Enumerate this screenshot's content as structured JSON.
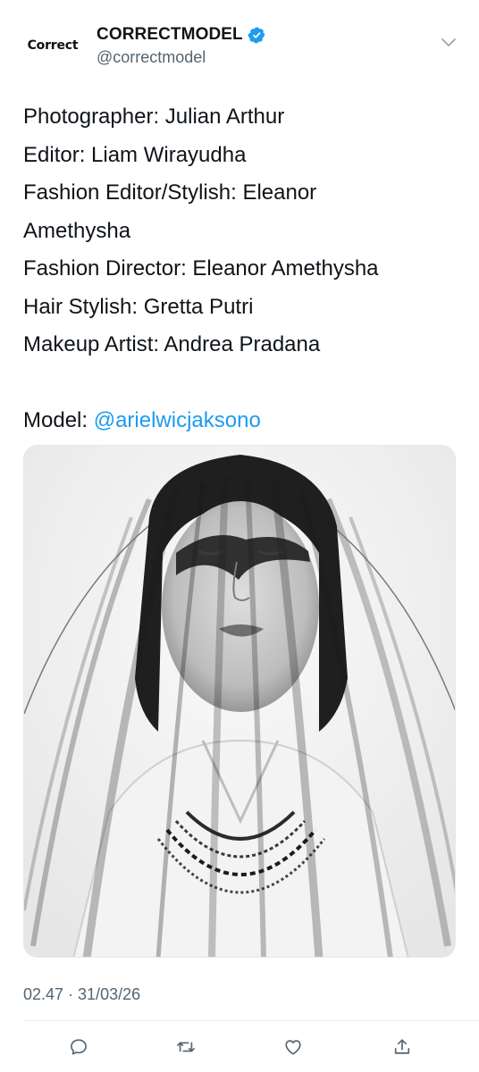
{
  "tweet": {
    "author": {
      "avatar_text": "Correct",
      "display_name": "CORRECTMODEL",
      "handle": "@correctmodel"
    },
    "body_lines": [
      "Photographer: Julian Arthur",
      "Editor: Liam Wirayudha",
      "Fashion Editor/Stylish: Eleanor",
      "Amethysha",
      "Fashion Director: Eleanor Amethysha",
      "Hair Stylish: Gretta Putri",
      "Makeup Artist: Andrea Pradana"
    ],
    "model_label": "Model:",
    "model_mention": "@arielwicjaksono",
    "timestamp": "02.47 · 31/03/26"
  },
  "icons": {
    "verified": "verified-badge-icon",
    "more": "chevron-down-icon",
    "reply": "reply-icon",
    "retweet": "retweet-icon",
    "like": "heart-icon",
    "share": "share-icon"
  },
  "colors": {
    "link": "#1d9bf0",
    "secondary_text": "#536471",
    "verified": "#1d9bf0",
    "icon": "#536471"
  }
}
